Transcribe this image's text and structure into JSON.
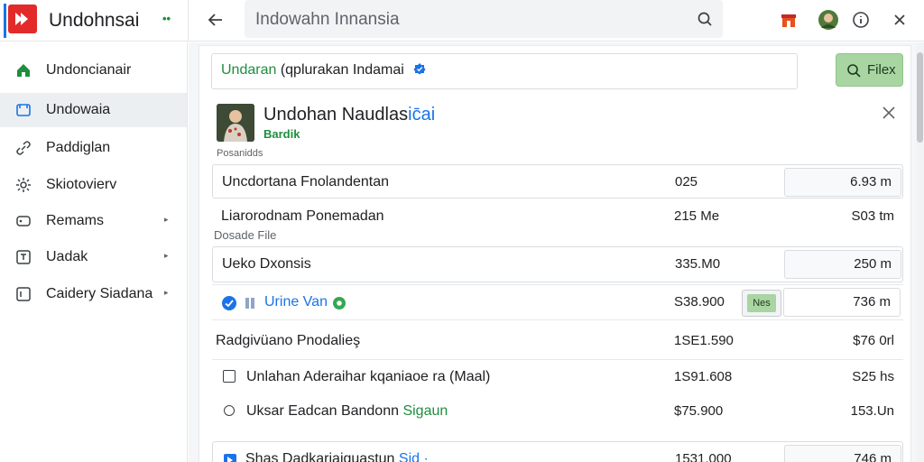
{
  "app": {
    "title": "Undohnsai",
    "title_suffix": "••",
    "search_text": "Indowahn Innansia"
  },
  "colors": {
    "accent": "#1a73e8",
    "brand": "#e32a2a",
    "success": "#1e8e3e",
    "button_green": "#a8d5a2"
  },
  "icons": {
    "back": "arrow-left-icon",
    "search": "search-icon",
    "store": "store-icon",
    "account": "avatar",
    "info": "info-icon",
    "close": "close-icon"
  },
  "sidebar": {
    "items": [
      {
        "label": "Undoncianair",
        "icon": "home-icon",
        "active": false,
        "caret": ""
      },
      {
        "label": "Undowaia",
        "icon": "inbox-icon",
        "active": true,
        "caret": ""
      },
      {
        "label": "Paddiglan",
        "icon": "link-icon",
        "active": false,
        "caret": ""
      },
      {
        "label": "Skiotovierv",
        "icon": "gear-icon",
        "active": false,
        "caret": ""
      },
      {
        "label": "Remams",
        "icon": "tag-icon",
        "active": false,
        "caret": "▸"
      },
      {
        "label": "Uadak",
        "icon": "document-icon",
        "active": false,
        "caret": "▸"
      },
      {
        "label": "Caidery Siadana",
        "icon": "list-icon",
        "active": false,
        "caret": "▸"
      }
    ]
  },
  "filter": {
    "text_highlight": "Undaran",
    "text_rest": " (qplurakan Indamai",
    "button_label": "Filex"
  },
  "product": {
    "title": "Undohan Naudlas",
    "title_suffix": "ic̄ai",
    "subtitle": "Bardik",
    "section_caption": "Posanidds"
  },
  "rows": [
    {
      "label": "Uncdortana Fnolandentan",
      "value": "025",
      "box": "6.93 m",
      "style": "boxed"
    },
    {
      "label": "Liarorodnam Ponemadan",
      "caption": "Dosade File",
      "value": "215 Me",
      "right": "S03 tm",
      "style": "plain"
    },
    {
      "label": "Ueko Dxonsis",
      "value": "335.M0",
      "box": "250 m",
      "style": "boxed"
    },
    {
      "label": "Urine Van",
      "value": "S38.900",
      "pill": "Nes",
      "box": "736 m",
      "style": "link"
    },
    {
      "label": "Radgivüano Pnodalieş",
      "value": "1SE1.590",
      "right": "$76 0rl",
      "style": "heading"
    },
    {
      "label": "Unlahan Aderaihar kqaniaoe ra (Maal)",
      "value": "1S91.608",
      "right": "S25 hs",
      "style": "checkbox"
    },
    {
      "label": "Uksar Eadcan Bandonn",
      "label_green": "Sigaun",
      "value": "$75.900",
      "right": "153.Un",
      "style": "radio"
    },
    {
      "label": "Shas Dadkariaiguastun",
      "label_blue": "Sid ·",
      "value": "1531.000",
      "box": "746 m",
      "style": "boxed-link"
    }
  ]
}
